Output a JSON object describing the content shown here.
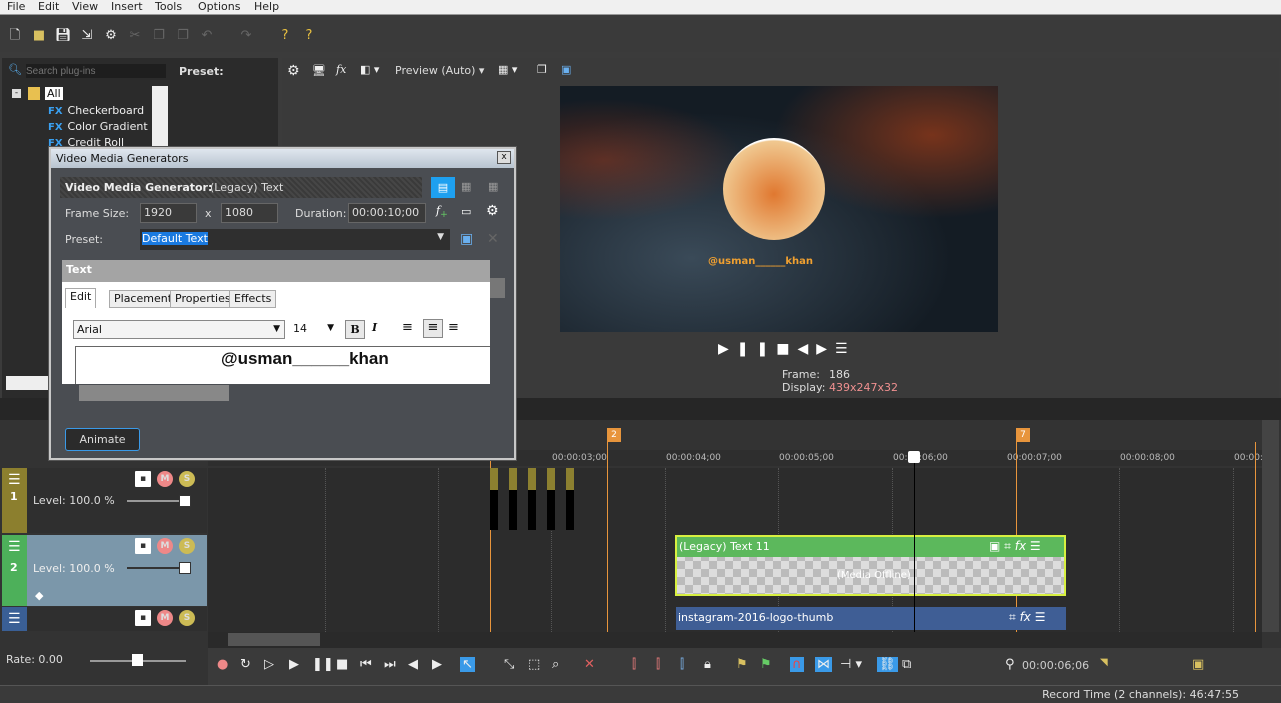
{
  "menu": [
    "File",
    "Edit",
    "View",
    "Insert",
    "Tools",
    "Options",
    "Help"
  ],
  "plugins": {
    "search_placeholder": "Search plug-ins",
    "preset_label": "Preset:",
    "root": "All",
    "items": [
      "Checkerboard",
      "Color Gradient",
      "Credit Roll"
    ]
  },
  "preview": {
    "quality": "Preview (Auto)",
    "frame_label": "Frame:",
    "frame": "186",
    "display_label": "Display:",
    "display": "439x247x32",
    "overlay_text": "@usman______khan"
  },
  "dialog": {
    "window_title": "Video Media Generators",
    "header": "Video Media Generator:",
    "generator": "(Legacy) Text",
    "frame_size_label": "Frame Size:",
    "width": "1920",
    "x": "x",
    "height": "1080",
    "duration_label": "Duration:",
    "duration": "00:00:10;00",
    "preset_label": "Preset:",
    "preset": "Default Text",
    "section": "Text",
    "tabs": [
      "Edit",
      "Placement",
      "Properties",
      "Effects"
    ],
    "font": "Arial",
    "size": "14",
    "bold": "B",
    "italic": "I",
    "text": "@usman______khan",
    "animate": "Animate"
  },
  "timeline": {
    "ruler": [
      "00:00:03;00",
      "00:00:04;00",
      "00:00:05;00",
      "00:00:06;00",
      "00:00:07;00",
      "00:00:08;00",
      "00:00:0"
    ],
    "markers": [
      "2",
      "7"
    ],
    "tracks": [
      {
        "number": "1",
        "level": "Level: 100.0 %",
        "color": "#8c7f2e"
      },
      {
        "number": "2",
        "level": "Level: 100.0 %",
        "color": "#4db05a"
      },
      {
        "number": "",
        "level": "",
        "color": "#3a5f95"
      }
    ],
    "clips": [
      {
        "name": "(Legacy) Text 11",
        "status": "(Media Offline)"
      },
      {
        "name": "instagram-2016-logo-thumb"
      }
    ]
  },
  "transport": {
    "rate": "Rate: 0.00",
    "time": "00:00:06;06"
  },
  "status": {
    "record_time": "Record Time (2 channels): 46:47:55"
  }
}
